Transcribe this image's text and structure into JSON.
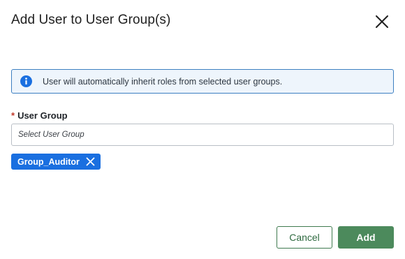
{
  "dialog": {
    "title": "Add User to User Group(s)",
    "close_icon": "close-icon"
  },
  "info": {
    "icon": "info-icon",
    "message": "User will automatically inherit roles from selected user groups."
  },
  "user_group_field": {
    "required_marker": "*",
    "label": "User Group",
    "placeholder": "Select User Group",
    "value": ""
  },
  "selected_groups": [
    {
      "label": "Group_Auditor",
      "remove_icon": "close-icon"
    }
  ],
  "actions": {
    "cancel_label": "Cancel",
    "add_label": "Add"
  },
  "colors": {
    "info_border": "#3d7fc1",
    "info_background": "#eef5fc",
    "info_icon": "#1a6fe0",
    "chip_background": "#1a6fe0",
    "primary_button": "#4c8a5c",
    "secondary_button_border": "#3f7a4f",
    "required_marker": "#c0392b"
  }
}
